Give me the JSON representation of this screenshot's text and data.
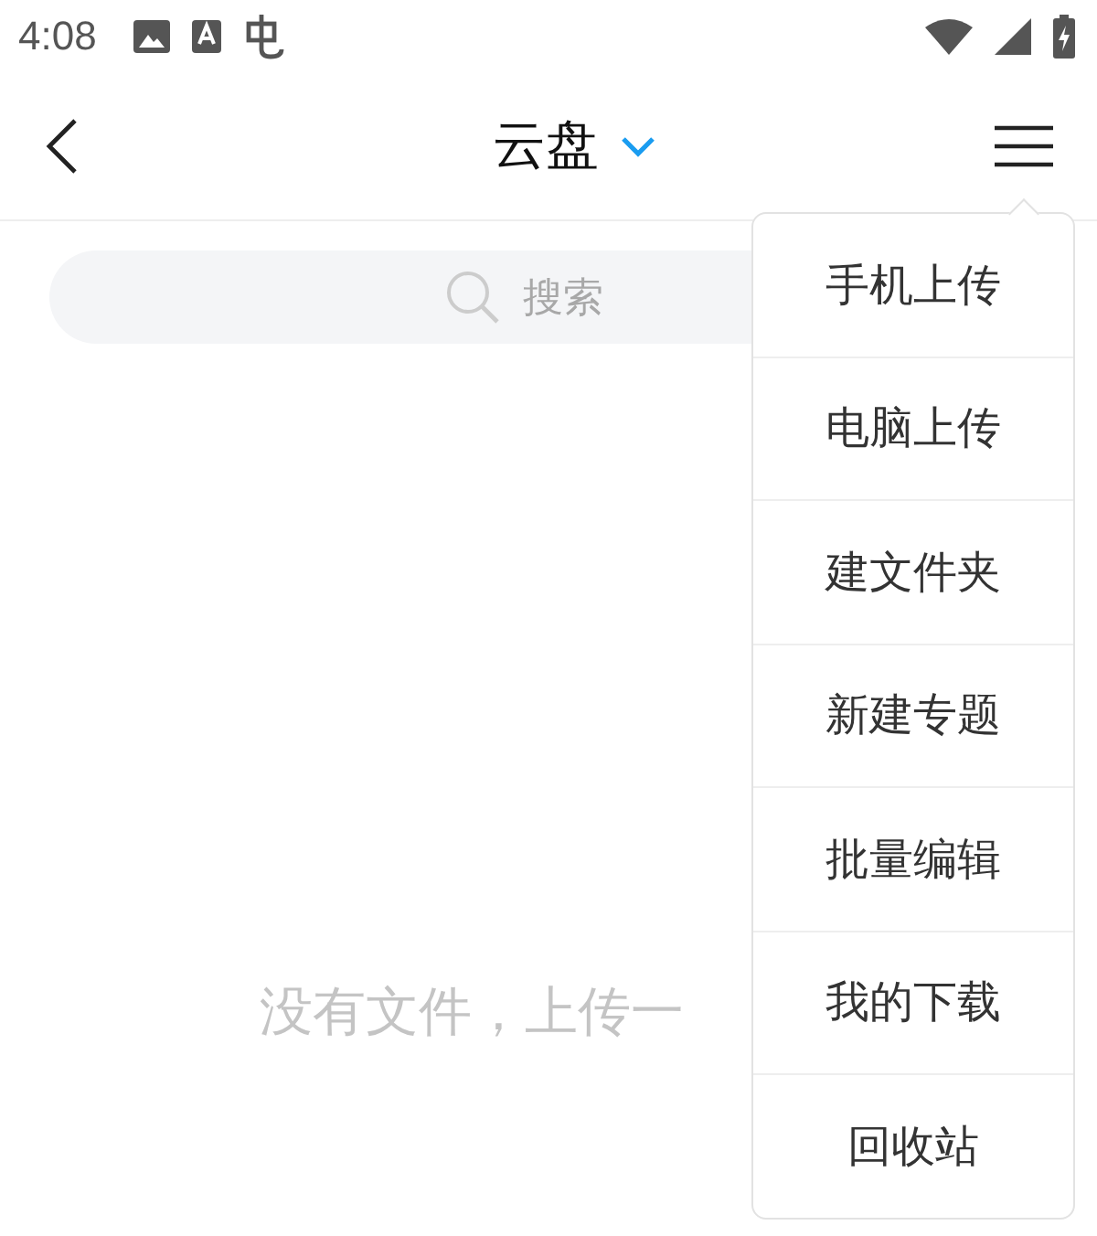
{
  "status_bar": {
    "time": "4:08"
  },
  "header": {
    "title": "云盘"
  },
  "search": {
    "placeholder": "搜索"
  },
  "empty_message": "没有文件，上传一",
  "menu": {
    "items": [
      {
        "label": "手机上传"
      },
      {
        "label": "电脑上传"
      },
      {
        "label": "建文件夹"
      },
      {
        "label": "新建专题"
      },
      {
        "label": "批量编辑"
      },
      {
        "label": "我的下载"
      },
      {
        "label": "回收站"
      }
    ]
  }
}
